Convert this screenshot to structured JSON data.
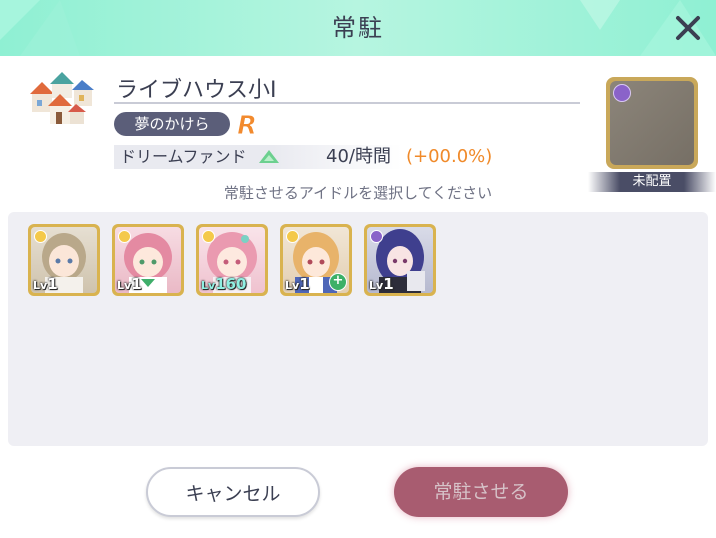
{
  "header": {
    "title": "常駐",
    "close_icon": "close-icon"
  },
  "building": {
    "icon": "houses-icon",
    "name": "ライブハウス小Ⅰ",
    "group": "夢のかけら",
    "rarity": "R",
    "stat": {
      "label": "ドリームファンド",
      "value": "40/時間",
      "change": "(+00.0%)",
      "trend_icon": "up-arrow-icon"
    }
  },
  "slot": {
    "status": "未配置",
    "attribute_icon": "attribute-icon"
  },
  "instruction": "常駐させるアイドルを選択してください",
  "idols": [
    {
      "level_prefix": "Lv",
      "level": "1",
      "attribute": "gold",
      "hair": "#b9a88a"
    },
    {
      "level_prefix": "Lv",
      "level": "1",
      "attribute": "gold",
      "hair": "#e48aa2"
    },
    {
      "level_prefix": "Lv",
      "level": "160",
      "attribute": "gold",
      "hair": "#ea9ab0"
    },
    {
      "level_prefix": "Lv",
      "level": "1",
      "attribute": "gold",
      "hair": "#e8b36a",
      "plus": true
    },
    {
      "level_prefix": "Lv",
      "level": "1",
      "attribute": "purple",
      "hair": "#3f3f8e"
    }
  ],
  "buttons": {
    "cancel": "キャンセル",
    "confirm": "常駐させる"
  },
  "colors": {
    "header": "#8ff0d3",
    "confirm": "#a85c70",
    "accent_orange": "#f08a2a",
    "card_gold": "#d9b34f"
  }
}
